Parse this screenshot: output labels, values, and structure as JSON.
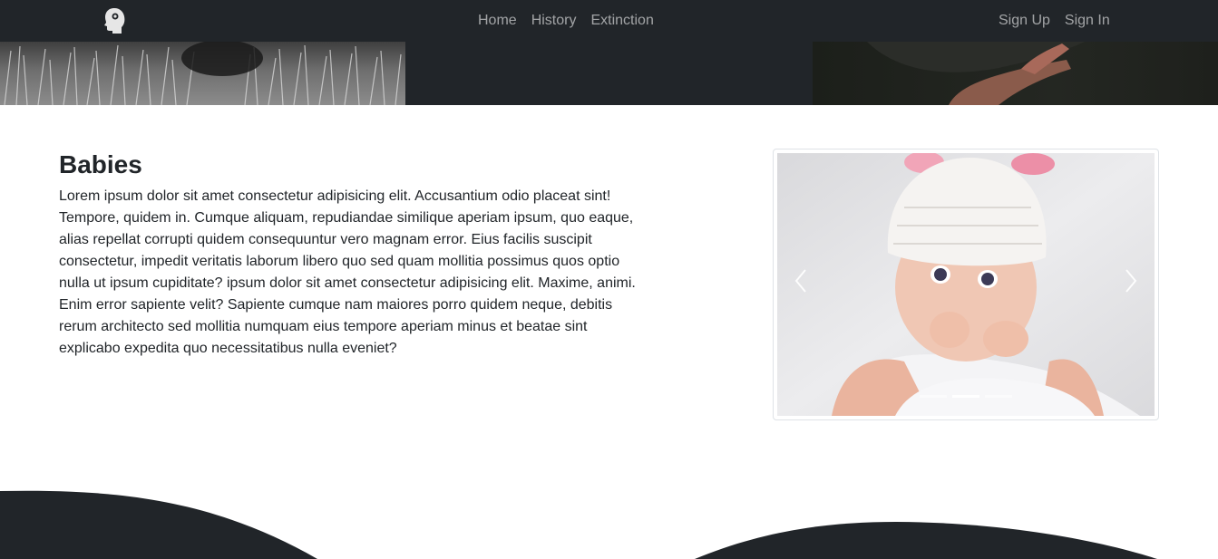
{
  "navbar": {
    "brand_icon": "head-silhouette-icon",
    "center_links": [
      "Home",
      "History",
      "Extinction"
    ],
    "right_links": [
      "Sign Up",
      "Sign In"
    ]
  },
  "section": {
    "title": "Babies",
    "paragraph": "Lorem ipsum dolor sit amet consectetur adipisicing elit. Accusantium odio placeat sint! Tempore, quidem in. Cumque aliquam, repudiandae similique aperiam ipsum, quo eaque, alias repellat corrupti quidem consequuntur vero magnam error. Eius facilis suscipit consectetur, impedit veritatis laborum libero quo sed quam mollitia possimus quos optio nulla ut ipsum cupiditate? ipsum dolor sit amet consectetur adipisicing elit. Maxime, animi. Enim error sapiente velit? Sapiente cumque nam maiores porro quidem neque, debitis rerum architecto sed mollitia numquam eius tempore aperiam minus et beatae sint explicabo expedita quo necessitatibus nulla eveniet?"
  },
  "carousel": {
    "slide_count": 3,
    "active_index": 1,
    "prev_icon": "chevron-left-icon",
    "next_icon": "chevron-right-icon"
  },
  "colors": {
    "dark": "#212529",
    "nav_link": "rgba(255,255,255,0.58)"
  }
}
